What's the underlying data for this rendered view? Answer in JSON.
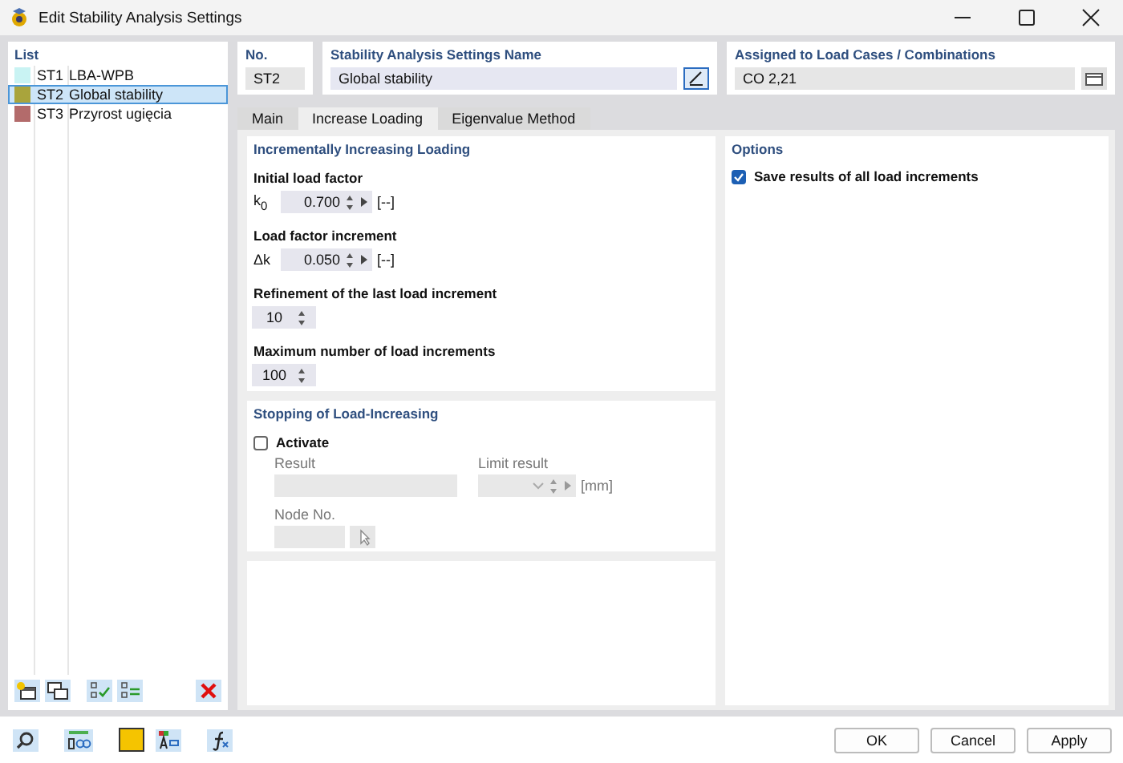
{
  "window": {
    "title": "Edit Stability Analysis Settings"
  },
  "list": {
    "title": "List",
    "items": [
      {
        "number": "ST1",
        "name": "LBA-WPB",
        "color": "#c9f3f3",
        "selected": false
      },
      {
        "number": "ST2",
        "name": "Global stability",
        "color": "#a9a43c",
        "selected": true
      },
      {
        "number": "ST3",
        "name": "Przyrost ugięcia",
        "color": "#b36b6b",
        "selected": false
      }
    ]
  },
  "number": {
    "label": "No.",
    "value": "ST2"
  },
  "name": {
    "label": "Stability Analysis Settings Name",
    "value": "Global stability"
  },
  "assigned": {
    "label": "Assigned to Load Cases / Combinations",
    "value": "CO 2,21"
  },
  "tabs": [
    {
      "label": "Main",
      "selected": false
    },
    {
      "label": "Increase Loading",
      "selected": true
    },
    {
      "label": "Eigenvalue Method",
      "selected": false
    }
  ],
  "incremental": {
    "title": "Incrementally Increasing Loading",
    "fields": [
      {
        "kind": "factor",
        "label": "Initial load factor",
        "symbol": "k$_{0}$",
        "value": "0.700",
        "unit": "[--]"
      },
      {
        "kind": "factor",
        "label": "Load factor increment",
        "symbol": "Δk",
        "value": "0.050",
        "unit": "[--]"
      },
      {
        "kind": "count",
        "label": "Refinement of the last load increment",
        "value": "10"
      },
      {
        "kind": "count",
        "label": "Maximum number of load increments",
        "value": "100"
      }
    ]
  },
  "stopping": {
    "title": "Stopping of Load-Increasing",
    "activate": {
      "label": "Activate",
      "checked": false
    },
    "result_label": "Result",
    "limit_label": "Limit result",
    "unit": "[mm]",
    "node_label": "Node No."
  },
  "options": {
    "title": "Options",
    "save_all": {
      "label": "Save results of all load increments",
      "checked": true
    }
  },
  "buttons": [
    {
      "label": "OK"
    },
    {
      "label": "Cancel"
    },
    {
      "label": "Apply"
    }
  ]
}
